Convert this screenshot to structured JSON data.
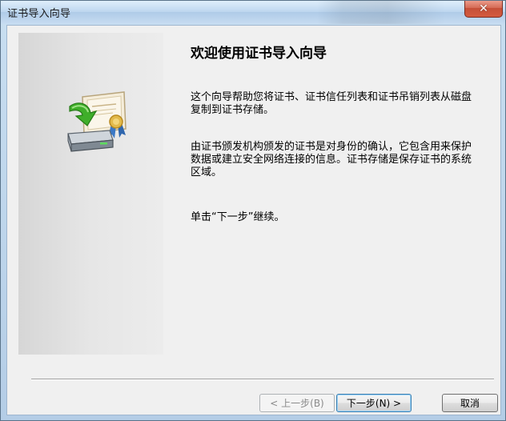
{
  "window": {
    "title": "证书导入向导"
  },
  "titlebar": {
    "close_icon": "✕"
  },
  "wizard": {
    "heading": "欢迎使用证书导入向导",
    "paragraphs": [
      "这个向导帮助您将证书、证书信任列表和证书吊销列表从磁盘复制到证书存储。",
      "由证书颁发机构颁发的证书是对身份的确认，它包含用来保护数据或建立安全网络连接的信息。证书存储是保存证书的系统区域。",
      "单击“下一步”继续。"
    ]
  },
  "buttons": {
    "back": "< 上一步(B)",
    "next": "下一步(N) >",
    "cancel": "取消"
  }
}
